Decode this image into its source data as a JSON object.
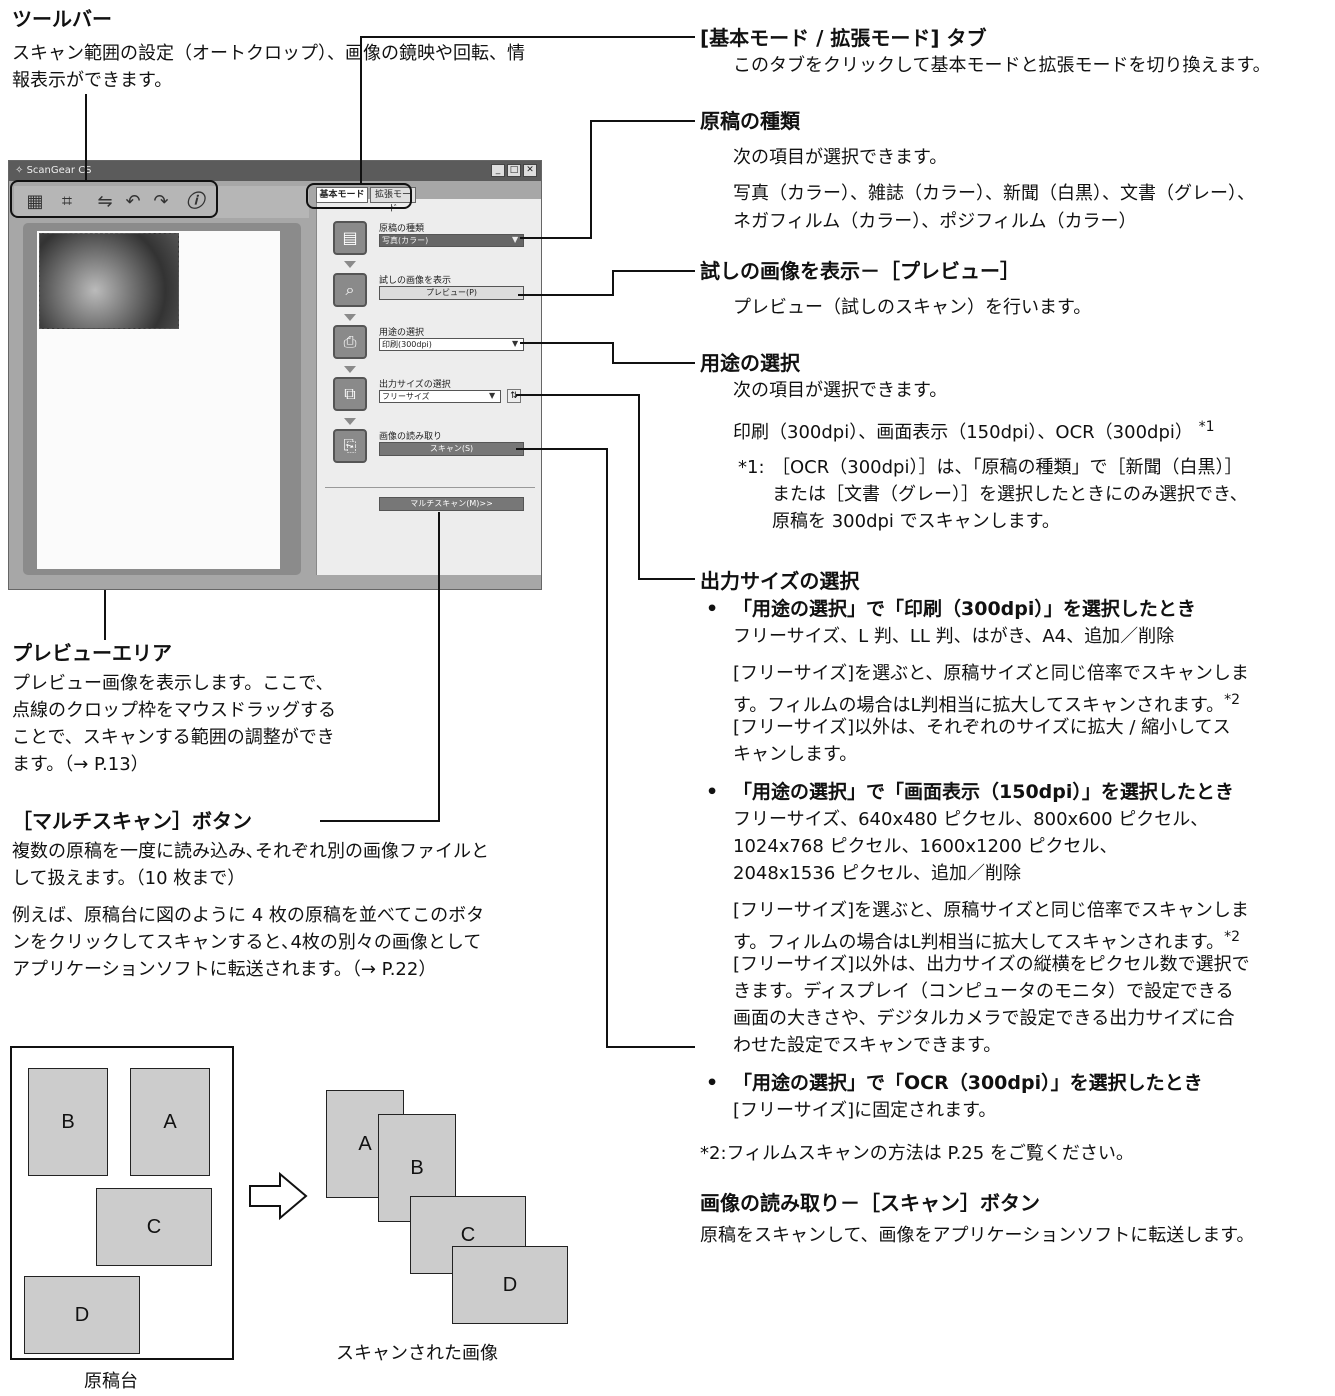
{
  "toolbar_section": {
    "title": "ツールバー",
    "desc": "スキャン範囲の設定（オートクロップ）、画像の鏡映や回転、情報表示ができます。"
  },
  "window": {
    "title": "ScanGear CS",
    "tabs": [
      "基本モード",
      "拡張モード"
    ],
    "doc_type_label": "原稿の種類",
    "doc_type_value": "写真(カラー)",
    "preview_label": "試しの画像を表示",
    "preview_button": "プレビュー(P)",
    "purpose_label": "用途の選択",
    "purpose_value": "印刷(300dpi)",
    "output_size_label": "出力サイズの選択",
    "output_size_value": "フリーサイズ",
    "scan_label": "画像の読み取り",
    "scan_button": "スキャン(S)",
    "multiscan_button": "マルチスキャン(M)>>"
  },
  "tab_section": {
    "title": "[基本モード / 拡張モード] タブ",
    "desc": "このタブをクリックして基本モードと拡張モードを切り換えます。"
  },
  "doc_type_section": {
    "title": "原稿の種類",
    "line1": "次の項目が選択できます。",
    "line2": "写真（カラー）、雑誌（カラー）、新聞（白黒）、文書（グレー）、",
    "line3": "ネガフィルム（カラー）、ポジフィルム（カラー）"
  },
  "preview_section": {
    "title": "試しの画像を表示－［プレビュー］",
    "desc": "プレビュー（試しのスキャン）を行います。"
  },
  "purpose_section": {
    "title": "用途の選択",
    "line1": "次の項目が選択できます。",
    "line2": "印刷（300dpi）、画面表示（150dpi）、OCR（300dpi）",
    "line2_sup": "*1",
    "note_mark": "*1:",
    "note_l1": "［OCR（300dpi）］は、「原稿の種類」で［新聞（白黒）］",
    "note_l2": "または［文書（グレー）］を選択したときにのみ選択でき、",
    "note_l3": "原稿を 300dpi でスキャンします。"
  },
  "output_section": {
    "title": "出力サイズの選択",
    "b1_head": "「用途の選択」で「印刷（300dpi）」を選択したとき",
    "b1_l1": "フリーサイズ、L 判、LL 判、はがき、A4、追加／削除",
    "b1_l2": "[フリーサイズ]を選ぶと、原稿サイズと同じ倍率でスキャンしま",
    "b1_l3": "す。フィルムの場合はL判相当に拡大してスキャンされます。",
    "b1_l3_sup": "*2",
    "b1_l4": "[フリーサイズ]以外は、それぞれのサイズに拡大 / 縮小してス",
    "b1_l5": "キャンします。",
    "b2_head": "「用途の選択」で「画面表示（150dpi）」を選択したとき",
    "b2_l1": "フリーサイズ、640x480 ピクセル、800x600 ピクセル、",
    "b2_l2": "1024x768 ピクセル、1600x1200 ピクセル、",
    "b2_l3": "2048x1536 ピクセル、追加／削除",
    "b2_l4": "[フリーサイズ]を選ぶと、原稿サイズと同じ倍率でスキャンしま",
    "b2_l5": "す。フィルムの場合はL判相当に拡大してスキャンされます。",
    "b2_l5_sup": "*2",
    "b2_l6": "[フリーサイズ]以外は、出力サイズの縦横をピクセル数で選択で",
    "b2_l7": "きます。ディスプレイ（コンピュータのモニタ）で設定できる",
    "b2_l8": "画面の大きさや、デジタルカメラで設定できる出力サイズに合",
    "b2_l9": "わせた設定でスキャンできます。",
    "b3_head": "「用途の選択」で「OCR（300dpi）」を選択したとき",
    "b3_l1": "[フリーサイズ]に固定されます。",
    "note2": "*2:フィルムスキャンの方法は P.25 をご覧ください。"
  },
  "scan_section": {
    "title": "画像の読み取り－［スキャン］ボタン",
    "desc": "原稿をスキャンして、画像をアプリケーションソフトに転送します。"
  },
  "preview_area_section": {
    "title": "プレビューエリア",
    "l1": "プレビュー画像を表示します。ここで、",
    "l2": "点線のクロップ枠をマウスドラッグする",
    "l3": "ことで、スキャンする範囲の調整ができ",
    "l4": "ます。（→ P.13）"
  },
  "multiscan_section": {
    "title": "［マルチスキャン］ボタン",
    "l1": "複数の原稿を一度に読み込み､それぞれ別の画像ファイルと",
    "l2": "して扱えます。（10 枚まで）",
    "l3": "例えば、原稿台に図のように 4 枚の原稿を並べてこのボタ",
    "l4": "ンをクリックしてスキャンすると､4枚の別々の画像として",
    "l5": "アプリケーションソフトに転送されます。（→ P.22）"
  },
  "diagram": {
    "platen_sheets": [
      "B",
      "A",
      "C",
      "D"
    ],
    "scanned_sheets": [
      "A",
      "B",
      "C",
      "D"
    ],
    "platen_caption": "原稿台",
    "scanned_caption": "スキャンされた画像"
  }
}
